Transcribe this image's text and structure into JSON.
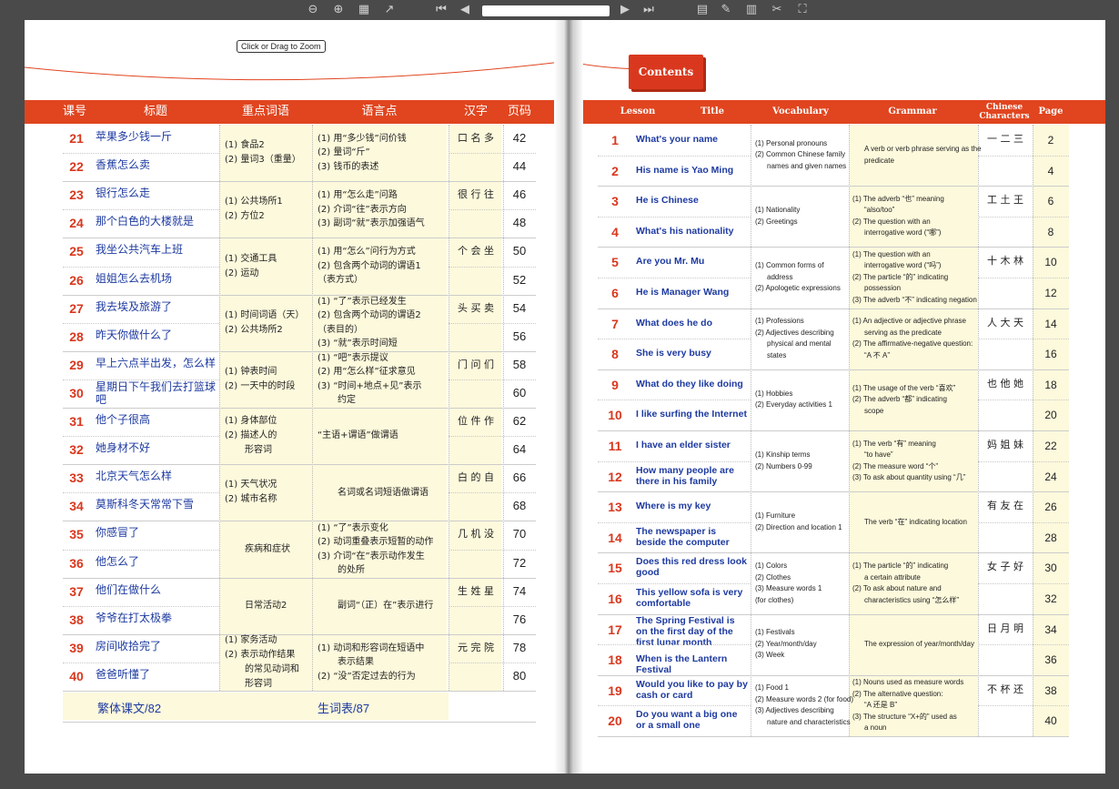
{
  "toolbar": {
    "icons": [
      "zoom-out-icon",
      "zoom-in-icon",
      "grid-icon",
      "share-icon",
      "first-page-icon",
      "prev-page-icon",
      "next-page-icon",
      "last-page-icon",
      "thumbnails-icon",
      "edit-icon",
      "print-icon",
      "tools-icon",
      "fullscreen-icon"
    ]
  },
  "zoom_hint": "Click or Drag to Zoom",
  "left": {
    "headers": [
      "课号",
      "标题",
      "重点词语",
      "语言点",
      "汉字",
      "页码"
    ],
    "lessons": [
      {
        "num": "21",
        "title": "苹果多少钱一斤",
        "page": "42"
      },
      {
        "num": "22",
        "title": "香蕉怎么卖",
        "page": "44"
      },
      {
        "num": "23",
        "title": "银行怎么走",
        "page": "46"
      },
      {
        "num": "24",
        "title": "那个白色的大楼就是",
        "page": "48"
      },
      {
        "num": "25",
        "title": "我坐公共汽车上班",
        "page": "50"
      },
      {
        "num": "26",
        "title": "姐姐怎么去机场",
        "page": "52"
      },
      {
        "num": "27",
        "title": "我去埃及旅游了",
        "page": "54"
      },
      {
        "num": "28",
        "title": "昨天你做什么了",
        "page": "56"
      },
      {
        "num": "29",
        "title": "早上六点半出发，怎么样",
        "page": "58"
      },
      {
        "num": "30",
        "title": "星期日下午我们去打篮球吧",
        "page": "60"
      },
      {
        "num": "31",
        "title": "他个子很高",
        "page": "62"
      },
      {
        "num": "32",
        "title": "她身材不好",
        "page": "64"
      },
      {
        "num": "33",
        "title": "北京天气怎么样",
        "page": "66"
      },
      {
        "num": "34",
        "title": "莫斯科冬天常常下雪",
        "page": "68"
      },
      {
        "num": "35",
        "title": "你感冒了",
        "page": "70"
      },
      {
        "num": "36",
        "title": "他怎么了",
        "page": "72"
      },
      {
        "num": "37",
        "title": "他们在做什么",
        "page": "74"
      },
      {
        "num": "38",
        "title": "爷爷在打太极拳",
        "page": "76"
      },
      {
        "num": "39",
        "title": "房间收拾完了",
        "page": "78"
      },
      {
        "num": "40",
        "title": "爸爸听懂了",
        "page": "80"
      }
    ],
    "groups": [
      {
        "vocab": [
          "(1) 食品2",
          "(2) 量词3（重量）"
        ],
        "grammar": [
          "(1) 用“多少钱”问价钱",
          "(2) 量词“斤”",
          "(3) 钱币的表述"
        ],
        "chars": "口 名 多"
      },
      {
        "vocab": [
          "(1) 公共场所1",
          "(2) 方位2"
        ],
        "grammar": [
          "(1) 用“怎么走”问路",
          "(2) 介词“往”表示方向",
          "(3) 副词“就”表示加强语气"
        ],
        "chars": "很 行 往"
      },
      {
        "vocab": [
          "(1) 交通工具",
          "(2) 运动"
        ],
        "grammar": [
          "(1) 用“怎么”问行为方式",
          "(2) 包含两个动词的谓语1",
          "（表方式）"
        ],
        "chars": "个 会 坐"
      },
      {
        "vocab": [
          "(1) 时间词语（天）",
          "(2) 公共场所2"
        ],
        "grammar": [
          "(1) “了”表示已经发生",
          "(2) 包含两个动词的谓语2",
          "（表目的）",
          "(3) “就”表示时间短"
        ],
        "chars": "头 买 卖"
      },
      {
        "vocab": [
          "(1) 钟表时间",
          "(2) 一天中的时段"
        ],
        "grammar": [
          "(1) “吧”表示提议",
          "(2) 用“怎么样”征求意见",
          "(3) “时间+地点+见”表示",
          "约定"
        ],
        "chars": "门 问 们"
      },
      {
        "vocab": [
          "(1) 身体部位",
          "(2) 描述人的",
          "形容词"
        ],
        "grammar": [
          "“主语+谓语”做谓语"
        ],
        "chars": "位 件 作"
      },
      {
        "vocab": [
          "(1) 天气状况",
          "(2) 城市名称"
        ],
        "grammar": [
          "名词或名词短语做谓语"
        ],
        "chars": "白 的 自"
      },
      {
        "vocab": [
          "疾病和症状"
        ],
        "grammar": [
          "(1) “了”表示变化",
          "(2) 动词重叠表示短暂的动作",
          "(3) 介词“在”表示动作发生",
          "的处所"
        ],
        "chars": "几 机 没"
      },
      {
        "vocab": [
          "日常活动2"
        ],
        "grammar": [
          "副词“（正）在”表示进行"
        ],
        "chars": "生 姓 星"
      },
      {
        "vocab": [
          "(1) 家务活动",
          "(2) 表示动作结果",
          "的常见动词和",
          "形容词"
        ],
        "grammar": [
          "(1) 动词和形容词在短语中",
          "表示结果",
          "(2) “没”否定过去的行为"
        ],
        "chars": "元 完 院"
      }
    ],
    "footer": [
      "繁体课文/82",
      "生词表/87"
    ]
  },
  "right": {
    "contents_label": "Contents",
    "headers": [
      "Lesson",
      "Title",
      "Vocabulary",
      "Grammar",
      "Chinese Characters",
      "Page"
    ],
    "lessons": [
      {
        "num": "1",
        "title": "What's your name",
        "page": "2"
      },
      {
        "num": "2",
        "title": "His name is Yao Ming",
        "page": "4"
      },
      {
        "num": "3",
        "title": "He is Chinese",
        "page": "6"
      },
      {
        "num": "4",
        "title": "What's his nationality",
        "page": "8"
      },
      {
        "num": "5",
        "title": "Are you Mr. Mu",
        "page": "10"
      },
      {
        "num": "6",
        "title": "He is Manager Wang",
        "page": "12"
      },
      {
        "num": "7",
        "title": "What does he do",
        "page": "14"
      },
      {
        "num": "8",
        "title": "She is very busy",
        "page": "16"
      },
      {
        "num": "9",
        "title": "What do they like doing",
        "page": "18"
      },
      {
        "num": "10",
        "title": "I like surfing the Internet",
        "page": "20"
      },
      {
        "num": "11",
        "title": "I have an elder sister",
        "page": "22"
      },
      {
        "num": "12",
        "title": "How many people are there in his family",
        "page": "24"
      },
      {
        "num": "13",
        "title": "Where is my key",
        "page": "26"
      },
      {
        "num": "14",
        "title": "The newspaper is beside the computer",
        "page": "28"
      },
      {
        "num": "15",
        "title": "Does this red dress look good",
        "page": "30"
      },
      {
        "num": "16",
        "title": "This yellow sofa is very comfortable",
        "page": "32"
      },
      {
        "num": "17",
        "title": "The Spring Festival is on the first day of the first lunar month",
        "page": "34"
      },
      {
        "num": "18",
        "title": "When is the Lantern Festival",
        "page": "36"
      },
      {
        "num": "19",
        "title": "Would you like to pay by cash or card",
        "page": "38"
      },
      {
        "num": "20",
        "title": "Do you want a big one or a small one",
        "page": "40"
      }
    ],
    "groups": [
      {
        "vocab": [
          "(1) Personal pronouns",
          "(2) Common Chinese family",
          "names and given names"
        ],
        "grammar": [
          "A verb or verb phrase serving as the",
          "predicate"
        ],
        "chars": "一 二 三"
      },
      {
        "vocab": [
          "(1) Nationality",
          "(2) Greetings"
        ],
        "grammar": [
          "(1) The adverb “也” meaning",
          "“also/too”",
          "(2) The question with an",
          "interrogative word (“哪”)"
        ],
        "chars": "工 土 王"
      },
      {
        "vocab": [
          "(1) Common forms of",
          "address",
          "(2) Apologetic expressions"
        ],
        "grammar": [
          "(1) The question with an",
          "interrogative word (“吗”)",
          "(2) The particle “的” indicating",
          "possession",
          "(3) The adverb “不” indicating negation"
        ],
        "chars": "十 木 林"
      },
      {
        "vocab": [
          "(1) Professions",
          "(2) Adjectives describing",
          "physical and mental",
          "states"
        ],
        "grammar": [
          "(1) An adjective or adjective phrase",
          "serving as the predicate",
          "(2) The affirmative-negative question:",
          "“A 不 A”"
        ],
        "chars": "人 大 天"
      },
      {
        "vocab": [
          "(1) Hobbies",
          "(2) Everyday activities 1"
        ],
        "grammar": [
          "(1) The usage of the verb “喜欢”",
          "(2) The adverb “都” indicating",
          "scope"
        ],
        "chars": "也 他 她"
      },
      {
        "vocab": [
          "(1) Kinship terms",
          "(2) Numbers 0-99"
        ],
        "grammar": [
          "(1) The verb “有” meaning",
          "“to have”",
          "(2) The measure word “个”",
          "(3) To ask about quantity using “几”"
        ],
        "chars": "妈 姐 妹"
      },
      {
        "vocab": [
          "(1) Furniture",
          "(2) Direction and location 1"
        ],
        "grammar": [
          "The verb “在” indicating location"
        ],
        "chars": "有 友 在"
      },
      {
        "vocab": [
          "(1) Colors",
          "(2) Clothes",
          "(3) Measure words 1",
          "(for clothes)"
        ],
        "grammar": [
          "(1) The particle “的” indicating",
          "a certain attribute",
          "(2) To ask about nature and",
          "characteristics using “怎么样”"
        ],
        "chars": "女 子 好"
      },
      {
        "vocab": [
          "(1) Festivals",
          "(2) Year/month/day",
          "(3) Week"
        ],
        "grammar": [
          "The expression of year/month/day"
        ],
        "chars": "日 月 明"
      },
      {
        "vocab": [
          "(1) Food 1",
          "(2) Measure words 2 (for food)",
          "(3) Adjectives describing",
          "nature and characteristics"
        ],
        "grammar": [
          "(1) Nouns used as measure words",
          "(2) The alternative question:",
          "“A 还是 B”",
          "(3) The structure “X+的” used as",
          "a noun"
        ],
        "chars": "不 杯 还"
      }
    ]
  }
}
